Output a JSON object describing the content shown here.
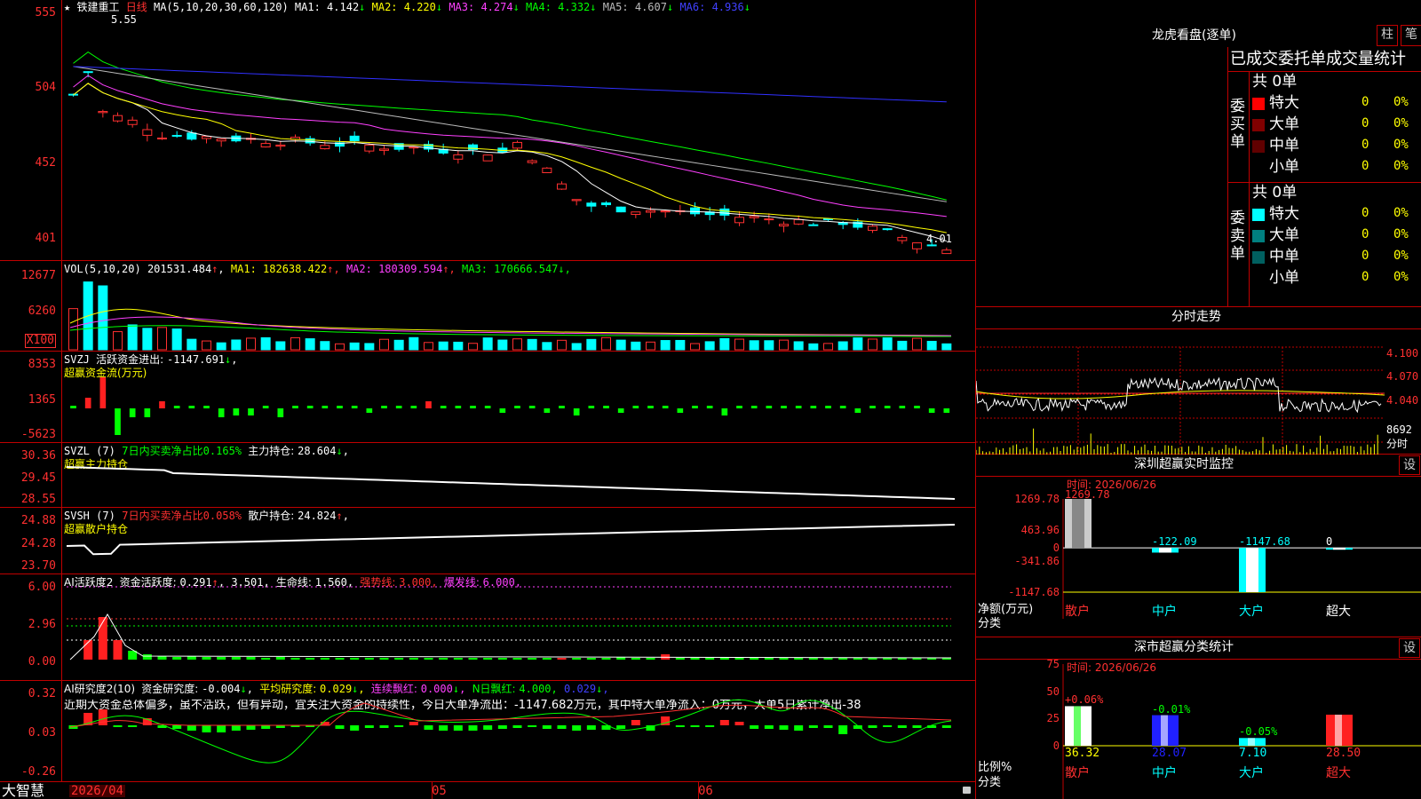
{
  "stock": {
    "name": "铁建重工",
    "period": "日线",
    "high_label": "5.55",
    "low_label": "4.01",
    "star": "★"
  },
  "main_pane": {
    "ma_title": "MA(5,10,20,30,60,120)",
    "ma": [
      {
        "label": "MA1: ",
        "value": "4.142",
        "arrow": "↓",
        "color": "#ffffff"
      },
      {
        "label": "MA2: ",
        "value": "4.220",
        "arrow": "↓",
        "color": "#ffff00"
      },
      {
        "label": "MA3: ",
        "value": "4.274",
        "arrow": "↓",
        "color": "#ff40ff"
      },
      {
        "label": "MA4: ",
        "value": "4.332",
        "arrow": "↓",
        "color": "#00ff00"
      },
      {
        "label": "MA5: ",
        "value": "4.607",
        "arrow": "↓",
        "color": "#bbbbbb"
      },
      {
        "label": "MA6: ",
        "value": "4.936",
        "arrow": "↓",
        "color": "#4040ff"
      }
    ],
    "yticks": [
      "555",
      "504",
      "452",
      "401"
    ]
  },
  "vol_pane": {
    "title": "VOL(5,10,20)",
    "value": "201531.484",
    "arrow": "↑",
    "ma": [
      {
        "label": "MA1: ",
        "value": "182638.422",
        "arrow": "↑",
        "color": "#ffff00"
      },
      {
        "label": "MA2: ",
        "value": "180309.594",
        "arrow": "↑",
        "color": "#ff40ff"
      },
      {
        "label": "MA3: ",
        "value": "170666.547",
        "arrow": "↓",
        "color": "#00ff00"
      }
    ],
    "yticks": [
      "12677",
      "6260",
      "X100"
    ]
  },
  "svzj_pane": {
    "title": "SVZJ",
    "label": "活跃资金进出: ",
    "value": "-1147.691",
    "arrow": "↓",
    "suffix": ",",
    "subtitle": "超赢资金流(万元)",
    "yticks": [
      "8353",
      "1365",
      "-5623"
    ]
  },
  "svzl_pane": {
    "title": "SVZL (7)",
    "l1": "7日内买卖净占比",
    "v1": "0.165%",
    "l2": "主力持仓: ",
    "v2": "28.604",
    "arrow": "↓",
    "suffix": ",",
    "subtitle": "超赢主力持仓",
    "yticks": [
      "30.36",
      "29.45",
      "28.55"
    ]
  },
  "svsh_pane": {
    "title": "SVSH (7)",
    "l1": "7日内买卖净占比",
    "v1": "0.058%",
    "l2": "散户持仓: ",
    "v2": "24.824",
    "arrow": "↑",
    "suffix": ",",
    "subtitle": "超赢散户持仓",
    "yticks": [
      "24.88",
      "24.28",
      "23.70"
    ]
  },
  "ai1_pane": {
    "title": "AI活跃度2",
    "l1": "资金活跃度: ",
    "v1": "0.291",
    "a1": "↑",
    "v2": "3.501",
    "l3": "生命线: ",
    "v3": "1.560",
    "l4": "强势线: ",
    "v4": "3.000",
    "l5": "爆发线: ",
    "v5": "6.000",
    "yticks": [
      "6.00",
      "2.96",
      "0.00"
    ]
  },
  "ai2_pane": {
    "title": "AI研究度2(10)",
    "l1": "资金研究度: ",
    "v1": "-0.004",
    "a1": "↓",
    "l2": "平均研究度: ",
    "v2": "0.029",
    "a2": "↓",
    "l3": "连续飘红: ",
    "v3": "0.000",
    "a3": "↓",
    "l4": "N日飘红: ",
    "v4": "4.000",
    "v5": "0.029",
    "a5": "↓",
    "comment": "近期大资金总体偏多，虽不活跃，但有异动，宜关注大资金的持续性，今日大单净流出：-1147.682万元，其中特大单净流入：0万元，大单5日累计净出-38",
    "yticks": [
      "0.32",
      "0.03",
      "-0.26"
    ]
  },
  "xaxis": {
    "brand": "大智慧",
    "dates": [
      "2026/04",
      "05",
      "06"
    ]
  },
  "right": {
    "lhb_title": "龙虎看盘(逐单)",
    "btn_zhu": "柱",
    "btn_bi": "笔",
    "header": "已成交委托单成交量统计",
    "buy": {
      "side": "委买单",
      "total": "共 0单",
      "rows": [
        {
          "name": "特大",
          "count": "0",
          "pct": "0%",
          "color": "#ff0000"
        },
        {
          "name": "大单",
          "count": "0",
          "pct": "0%",
          "color": "#800000"
        },
        {
          "name": "中单",
          "count": "0",
          "pct": "0%",
          "color": "#600000"
        },
        {
          "name": "小单",
          "count": "0",
          "pct": "0%",
          "color": "#000000"
        }
      ]
    },
    "sell": {
      "side": "委卖单",
      "total": "共 0单",
      "rows": [
        {
          "name": "特大",
          "count": "0",
          "pct": "0%",
          "color": "#00ffff"
        },
        {
          "name": "大单",
          "count": "0",
          "pct": "0%",
          "color": "#008080"
        },
        {
          "name": "中单",
          "count": "0",
          "pct": "0%",
          "color": "#006060"
        },
        {
          "name": "小单",
          "count": "0",
          "pct": "0%",
          "color": "#000000"
        }
      ]
    },
    "fenshi": {
      "title": "分时走势",
      "yticks": [
        "4.100",
        "4.070",
        "4.040"
      ],
      "vol_label": "8692",
      "vol_unit": "分时"
    },
    "monitor": {
      "title": "深圳超赢实时监控",
      "btn": "设",
      "time": "时间: 2026/06/26",
      "yticks": [
        "1269.78",
        "463.96",
        "0",
        "-341.86",
        "-1147.68"
      ],
      "unit1": "净额(万元)",
      "unit2": "分类",
      "bars": [
        {
          "cat": "散户",
          "value": "1269.78",
          "num": 1269.78
        },
        {
          "cat": "中户",
          "value": "-122.09",
          "num": -122.09
        },
        {
          "cat": "大户",
          "value": "-1147.68",
          "num": -1147.68
        },
        {
          "cat": "超大",
          "value": "0",
          "num": 0
        }
      ]
    },
    "classify": {
      "title": "深市超赢分类统计",
      "btn": "设",
      "time": "时间: 2026/06/26",
      "yticks": [
        "75",
        "50",
        "25",
        "0"
      ],
      "unit1": "比例%",
      "unit2": "分类",
      "bars": [
        {
          "cat": "散户",
          "pct": "36.32",
          "num": 36.32,
          "chg": "+0.06%",
          "color": "#ffffff",
          "accent": "#00ff00"
        },
        {
          "cat": "中户",
          "pct": "28.07",
          "num": 28.07,
          "chg": "-0.01%",
          "color": "#2020ff",
          "accent": "#ffffff"
        },
        {
          "cat": "大户",
          "pct": "7.10",
          "num": 7.1,
          "chg": "-0.05%",
          "color": "#00ffff",
          "accent": "#ffffff"
        },
        {
          "cat": "超大",
          "pct": "28.50",
          "num": 28.5,
          "chg": "",
          "color": "#ff2020",
          "accent": "#ffffff"
        }
      ]
    }
  }
}
